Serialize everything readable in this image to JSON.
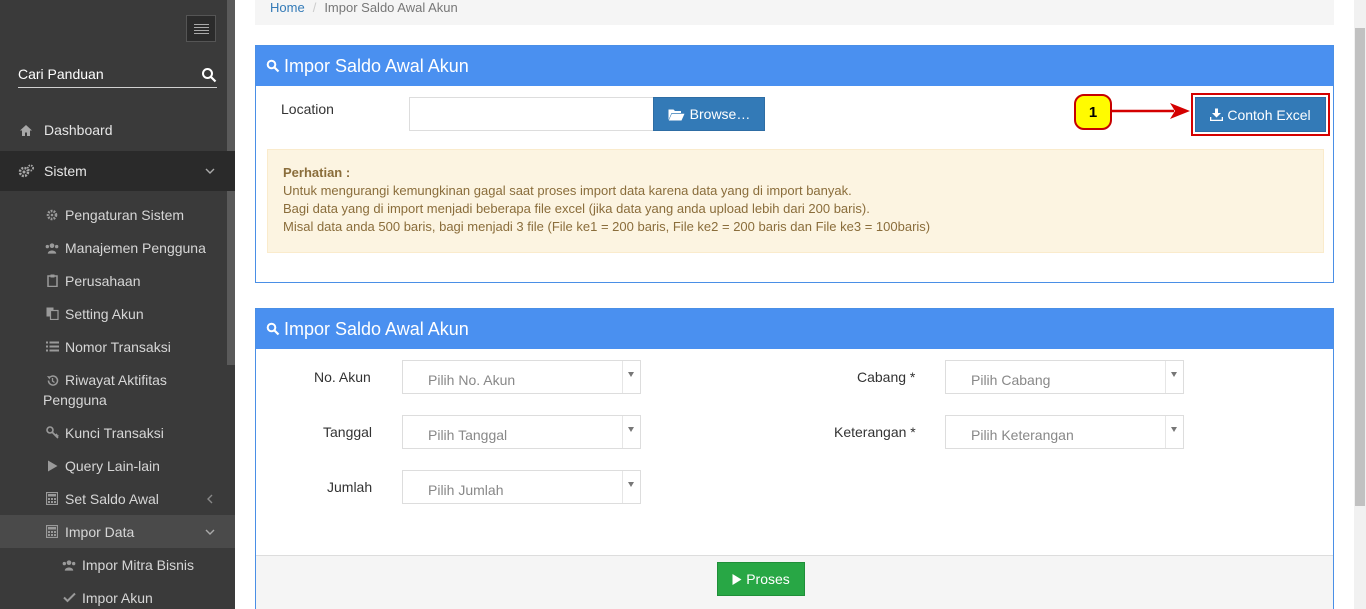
{
  "sidebar": {
    "search_label": "Cari Panduan",
    "items": [
      {
        "label": "Dashboard",
        "icon": "home-icon"
      },
      {
        "label": "Sistem",
        "icon": "gears-icon"
      },
      {
        "label": "Pengaturan Sistem",
        "icon": "gear-icon"
      },
      {
        "label": "Manajemen Pengguna",
        "icon": "users-icon"
      },
      {
        "label": "Perusahaan",
        "icon": "clipboard-icon"
      },
      {
        "label": "Setting Akun",
        "icon": "files-icon"
      },
      {
        "label": "Nomor Transaksi",
        "icon": "list-icon"
      },
      {
        "label_line1": "Riwayat Aktifitas",
        "label_line2": "Pengguna",
        "icon": "history-icon"
      },
      {
        "label": "Kunci Transaksi",
        "icon": "key-icon"
      },
      {
        "label": "Query Lain-lain",
        "icon": "play-icon"
      },
      {
        "label": "Set Saldo Awal",
        "icon": "calculator-icon"
      },
      {
        "label": "Impor Data",
        "icon": "calculator-icon"
      },
      {
        "label": "Impor Mitra Bisnis",
        "icon": "users-icon"
      },
      {
        "label": "Impor Akun",
        "icon": "check-icon"
      }
    ]
  },
  "breadcrumb": {
    "home": "Home",
    "current": "Impor Saldo Awal Akun"
  },
  "upload_panel": {
    "title": "Impor Saldo Awal Akun",
    "location_label": "Location",
    "file_value": "",
    "browse_label": "Browse…",
    "callout_number": "1",
    "sample_button_label": "Contoh Excel",
    "alert": {
      "title": "Perhatian :",
      "lines": [
        "Untuk mengurangi kemungkinan gagal saat proses import data karena data yang di import banyak.",
        "Bagi data yang di import menjadi beberapa file excel (jika data yang anda upload lebih dari 200 baris).",
        "Misal data anda 500 baris, bagi menjadi 3 file (File ke1 = 200 baris, File ke2 = 200 baris dan File ke3 = 100baris)"
      ]
    }
  },
  "form_panel": {
    "title": "Impor Saldo Awal Akun",
    "fields": {
      "no_akun": {
        "label": "No. Akun",
        "placeholder": "Pilih No. Akun"
      },
      "tanggal": {
        "label": "Tanggal",
        "placeholder": "Pilih Tanggal"
      },
      "jumlah": {
        "label": "Jumlah",
        "placeholder": "Pilih Jumlah"
      },
      "cabang": {
        "label": "Cabang *",
        "placeholder": "Pilih Cabang"
      },
      "keterangan": {
        "label": "Keterangan *",
        "placeholder": "Pilih Keterangan"
      }
    },
    "submit_label": "Proses"
  },
  "colors": {
    "sidebar_bg": "#3a3a3a",
    "panel_header": "#4a90f0",
    "primary_button": "#337ab7",
    "success_button": "#28a745",
    "alert_bg": "#fcf4e1",
    "annotation_red": "#d40000",
    "annotation_yellow": "#fffb00"
  }
}
